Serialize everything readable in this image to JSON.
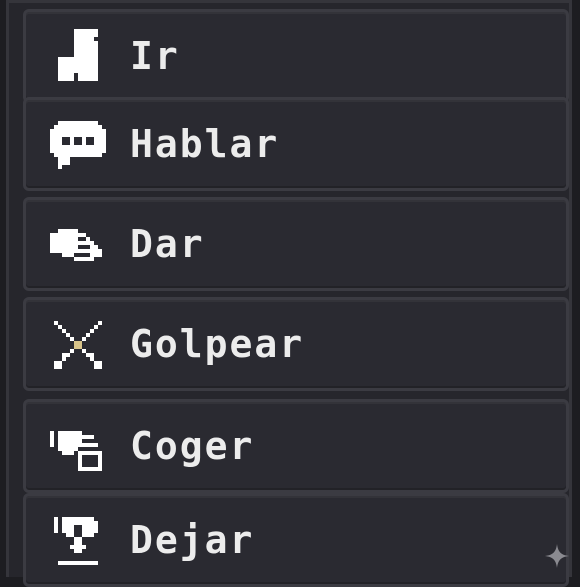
{
  "verb_menu": {
    "items": [
      {
        "label": "Ir",
        "icon": "boot-icon"
      },
      {
        "label": "Hablar",
        "icon": "speech-bubble-icon"
      },
      {
        "label": "Dar",
        "icon": "handshake-icon"
      },
      {
        "label": "Golpear",
        "icon": "crossed-swords-icon"
      },
      {
        "label": "Coger",
        "icon": "grab-hand-icon"
      },
      {
        "label": "Dejar",
        "icon": "drop-hand-icon"
      }
    ]
  },
  "colors": {
    "background": "#1d1d21",
    "panel": "#26262c",
    "button": "#2a2a31",
    "button_border": "#3b3b42",
    "text": "#ececec",
    "icon": "#ffffff"
  }
}
